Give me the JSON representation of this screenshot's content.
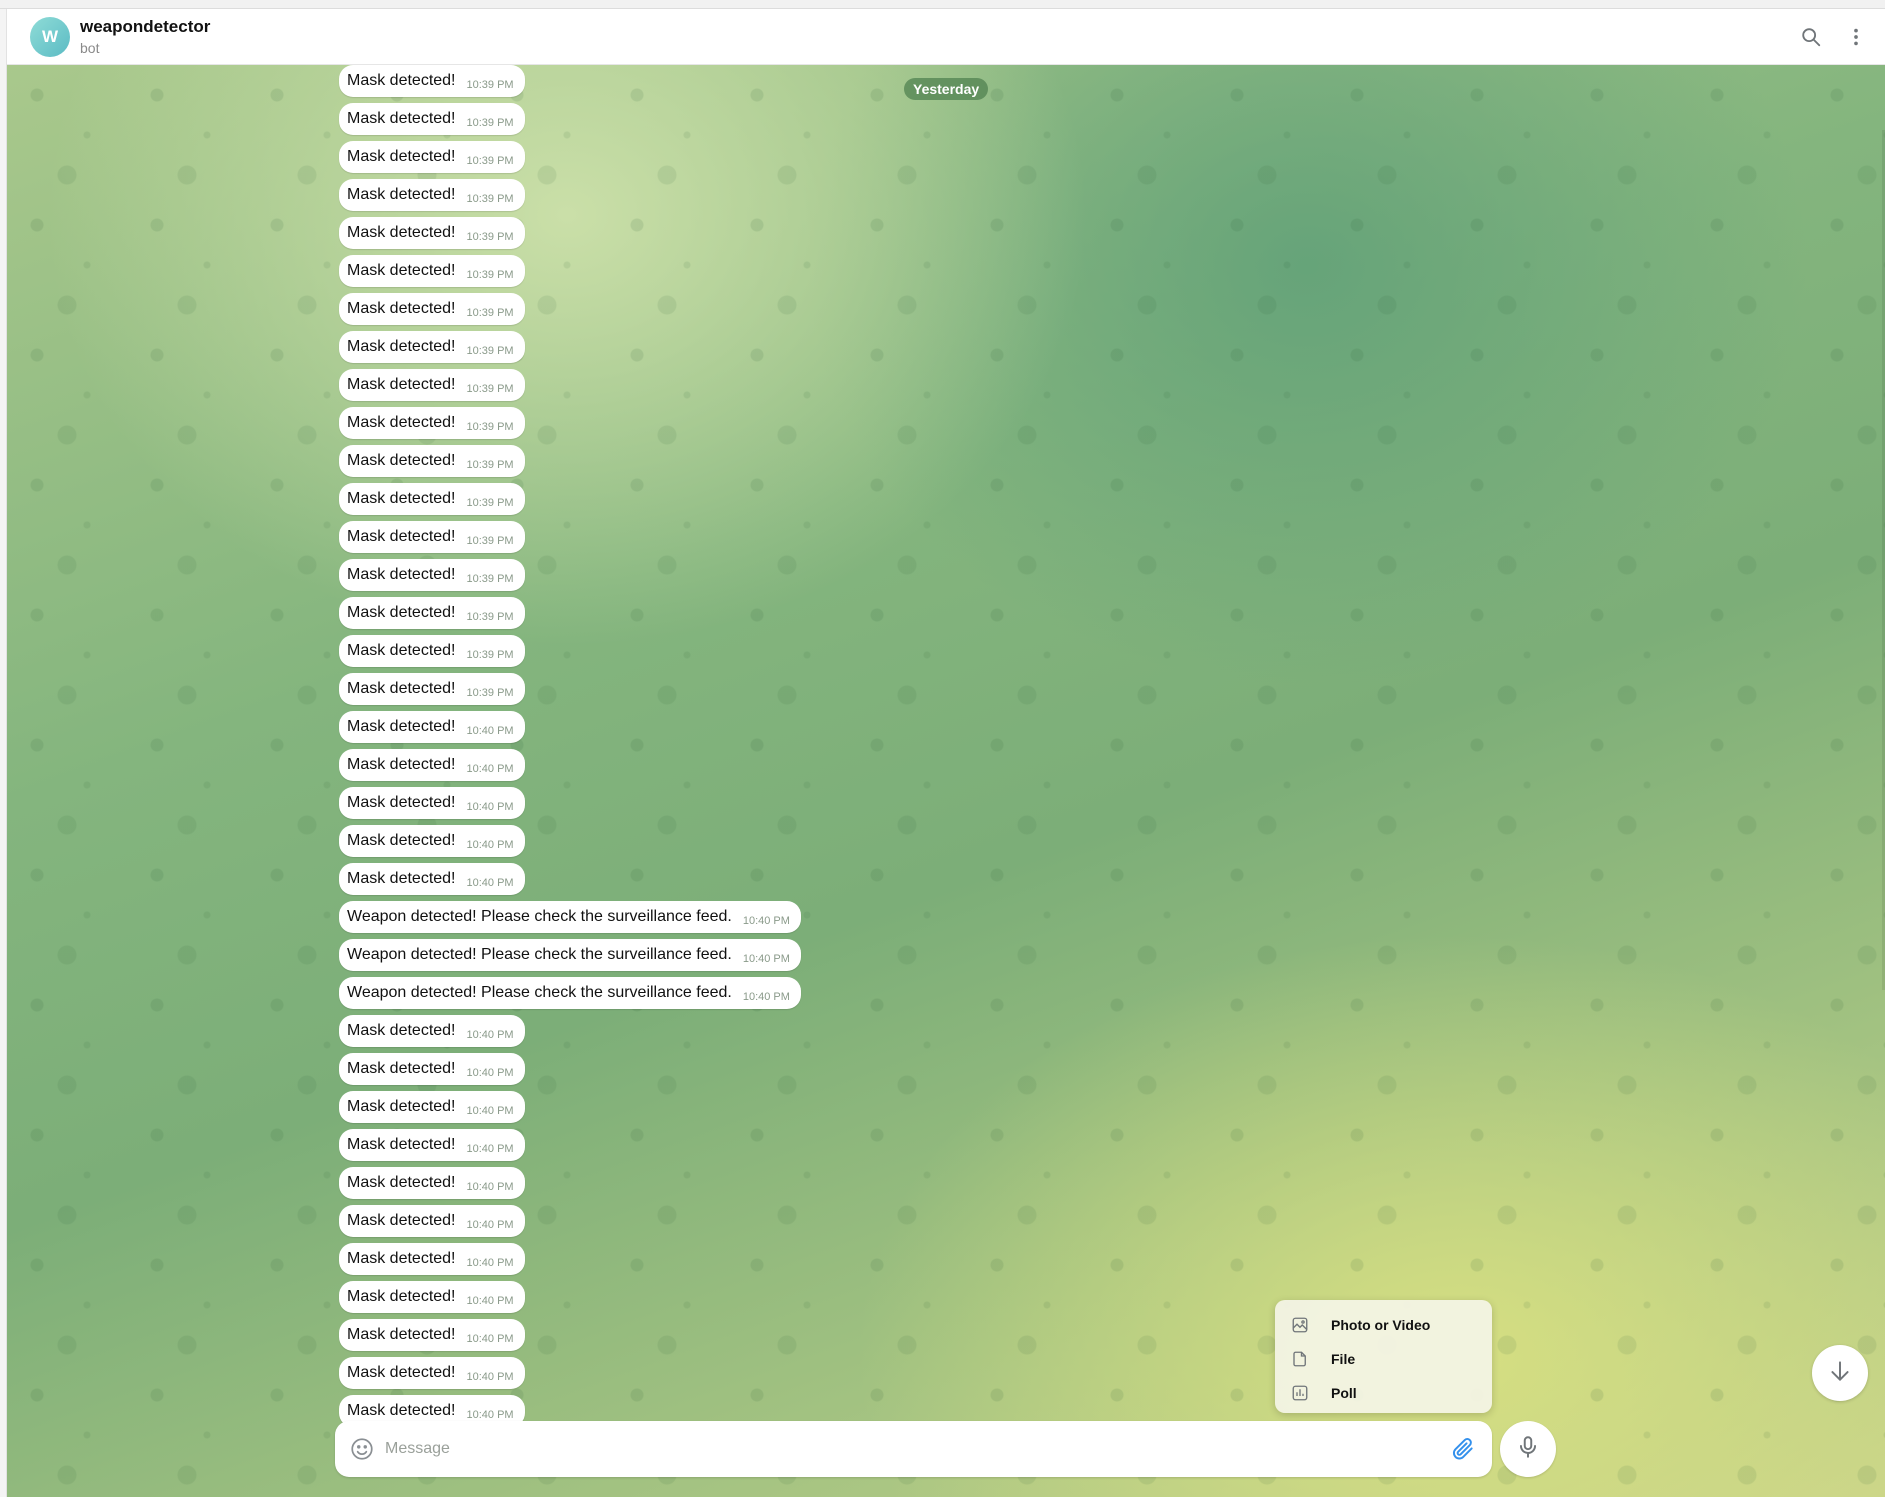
{
  "header": {
    "avatar_letter": "W",
    "title": "weapondetector",
    "subtitle": "bot",
    "icons": [
      "search-icon",
      "more-vertical-icon"
    ]
  },
  "chat": {
    "date_label": "Yesterday",
    "messages": [
      {
        "text": "Mask detected!",
        "time": "10:39 PM"
      },
      {
        "text": "Mask detected!",
        "time": "10:39 PM"
      },
      {
        "text": "Mask detected!",
        "time": "10:39 PM"
      },
      {
        "text": "Mask detected!",
        "time": "10:39 PM"
      },
      {
        "text": "Mask detected!",
        "time": "10:39 PM"
      },
      {
        "text": "Mask detected!",
        "time": "10:39 PM"
      },
      {
        "text": "Mask detected!",
        "time": "10:39 PM"
      },
      {
        "text": "Mask detected!",
        "time": "10:39 PM"
      },
      {
        "text": "Mask detected!",
        "time": "10:39 PM"
      },
      {
        "text": "Mask detected!",
        "time": "10:39 PM"
      },
      {
        "text": "Mask detected!",
        "time": "10:39 PM"
      },
      {
        "text": "Mask detected!",
        "time": "10:39 PM"
      },
      {
        "text": "Mask detected!",
        "time": "10:39 PM"
      },
      {
        "text": "Mask detected!",
        "time": "10:39 PM"
      },
      {
        "text": "Mask detected!",
        "time": "10:39 PM"
      },
      {
        "text": "Mask detected!",
        "time": "10:39 PM"
      },
      {
        "text": "Mask detected!",
        "time": "10:39 PM"
      },
      {
        "text": "Mask detected!",
        "time": "10:40 PM"
      },
      {
        "text": "Mask detected!",
        "time": "10:40 PM"
      },
      {
        "text": "Mask detected!",
        "time": "10:40 PM"
      },
      {
        "text": "Mask detected!",
        "time": "10:40 PM"
      },
      {
        "text": "Mask detected!",
        "time": "10:40 PM"
      },
      {
        "text": "Weapon detected! Please check the surveillance feed.",
        "time": "10:40 PM"
      },
      {
        "text": "Weapon detected! Please check the surveillance feed.",
        "time": "10:40 PM"
      },
      {
        "text": "Weapon detected! Please check the surveillance feed.",
        "time": "10:40 PM"
      },
      {
        "text": "Mask detected!",
        "time": "10:40 PM"
      },
      {
        "text": "Mask detected!",
        "time": "10:40 PM"
      },
      {
        "text": "Mask detected!",
        "time": "10:40 PM"
      },
      {
        "text": "Mask detected!",
        "time": "10:40 PM"
      },
      {
        "text": "Mask detected!",
        "time": "10:40 PM"
      },
      {
        "text": "Mask detected!",
        "time": "10:40 PM"
      },
      {
        "text": "Mask detected!",
        "time": "10:40 PM"
      },
      {
        "text": "Mask detected!",
        "time": "10:40 PM"
      },
      {
        "text": "Mask detected!",
        "time": "10:40 PM"
      },
      {
        "text": "Mask detected!",
        "time": "10:40 PM"
      },
      {
        "text": "Mask detected!",
        "time": "10:40 PM"
      }
    ]
  },
  "attach_menu": {
    "items": [
      {
        "label": "Photo or Video",
        "icon": "image-icon"
      },
      {
        "label": "File",
        "icon": "file-icon"
      },
      {
        "label": "Poll",
        "icon": "poll-icon"
      }
    ]
  },
  "composer": {
    "placeholder": "Message",
    "value": "",
    "icons": [
      "emoji-icon",
      "paperclip-icon",
      "microphone-icon"
    ]
  },
  "scroll_down_icon": "arrow-down-icon",
  "colors": {
    "accent": "#3390ec",
    "date_pill": "#5f8f5f",
    "bubble": "#ffffff"
  }
}
